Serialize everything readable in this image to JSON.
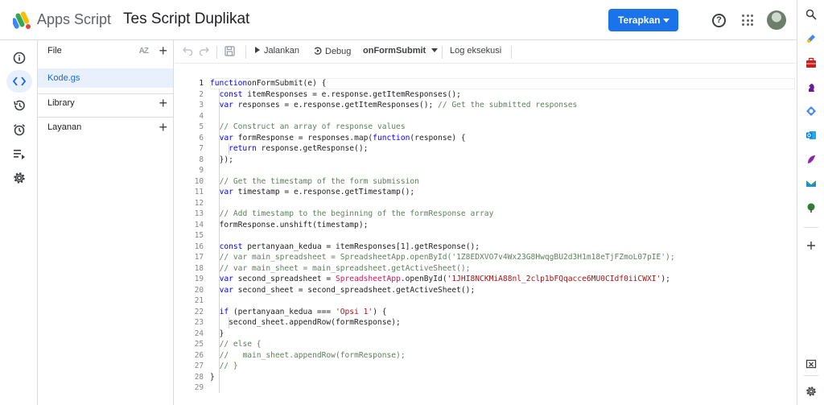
{
  "header": {
    "app_name": "Apps Script",
    "project_title": "Tes Script Duplikat",
    "deploy_label": "Terapkan",
    "icons": [
      "apps-script-logo",
      "help-icon",
      "google-apps-icon",
      "account-avatar"
    ]
  },
  "rail": {
    "items": [
      {
        "name": "overview",
        "icon": "info-icon"
      },
      {
        "name": "editor",
        "icon": "code-icon",
        "active": true
      },
      {
        "name": "project-history",
        "icon": "history-icon"
      },
      {
        "name": "triggers",
        "icon": "alarm-icon"
      },
      {
        "name": "executions",
        "icon": "executions-icon"
      },
      {
        "name": "settings",
        "icon": "gear-icon"
      }
    ]
  },
  "files": {
    "header_label": "File",
    "sort_label": "AZ",
    "file_name": "Kode.gs",
    "library_label": "Library",
    "services_label": "Layanan"
  },
  "toolbar": {
    "run_label": "Jalankan",
    "debug_label": "Debug",
    "function_label": "onFormSubmit",
    "log_label": "Log eksekusi"
  },
  "editor": {
    "line_numbers": [
      "1",
      "2",
      "3",
      "4",
      "5",
      "6",
      "7",
      "8",
      "9",
      "10",
      "11",
      "12",
      "13",
      "14",
      "15",
      "16",
      "17",
      "18",
      "19",
      "20",
      "21",
      "22",
      "23",
      "24",
      "25",
      "26",
      "27",
      "28",
      "29"
    ],
    "lines": [
      [
        [
          "kw",
          "function"
        ],
        [
          "",
          "onFormSubmit(e) {"
        ]
      ],
      [
        [
          "",
          "  "
        ],
        [
          "kw",
          "const"
        ],
        [
          "",
          " itemResponses = e.response.getItemResponses();"
        ]
      ],
      [
        [
          "",
          "  "
        ],
        [
          "kw",
          "var"
        ],
        [
          "",
          " responses = e.response.getItemResponses(); "
        ],
        [
          "cm",
          "// Get the submitted responses"
        ]
      ],
      [
        [
          "",
          ""
        ]
      ],
      [
        [
          "",
          "  "
        ],
        [
          "cm",
          "// Construct an array of response values"
        ]
      ],
      [
        [
          "",
          "  "
        ],
        [
          "kw",
          "var"
        ],
        [
          "",
          " formResponse = responses.map("
        ],
        [
          "kw",
          "function"
        ],
        [
          "",
          "(response) {"
        ]
      ],
      [
        [
          "",
          "    "
        ],
        [
          "kw",
          "return"
        ],
        [
          "",
          " response.getResponse();"
        ]
      ],
      [
        [
          "",
          "  });"
        ]
      ],
      [
        [
          "",
          ""
        ]
      ],
      [
        [
          "",
          "  "
        ],
        [
          "cm",
          "// Get the timestamp of the form submission"
        ]
      ],
      [
        [
          "",
          "  "
        ],
        [
          "kw",
          "var"
        ],
        [
          "",
          " timestamp = e.response.getTimestamp();"
        ]
      ],
      [
        [
          "",
          ""
        ]
      ],
      [
        [
          "",
          "  "
        ],
        [
          "cm",
          "// Add timestamp to the beginning of the formResponse array"
        ]
      ],
      [
        [
          "",
          "  formResponse.unshift(timestamp);"
        ]
      ],
      [
        [
          "",
          ""
        ]
      ],
      [
        [
          "",
          "  "
        ],
        [
          "kw",
          "const"
        ],
        [
          "",
          " pertanyaan_kedua = itemResponses[1].getResponse();"
        ]
      ],
      [
        [
          "",
          "  "
        ],
        [
          "cm",
          "// var main_spreadsheet = SpreadsheetApp.openById('1Z8EDXVO7v4Wx23G8HwqgBU2d3H1m18eTjFZmoL07pIE');"
        ]
      ],
      [
        [
          "",
          "  "
        ],
        [
          "cm",
          "// var main_sheet = main_spreadsheet.getActiveSheet();"
        ]
      ],
      [
        [
          "",
          "  "
        ],
        [
          "kw",
          "var"
        ],
        [
          "",
          " second_spreadsheet = "
        ],
        [
          "cls",
          "SpreadsheetApp"
        ],
        [
          "",
          ".openById("
        ],
        [
          "st",
          "'1JHI8NCKMiA88nl_2clp1bFQqacce6MU0CIdf0iiCWXI'"
        ],
        [
          "",
          ");"
        ]
      ],
      [
        [
          "",
          "  "
        ],
        [
          "kw",
          "var"
        ],
        [
          "",
          " second_sheet = second_spreadsheet.getActiveSheet();"
        ]
      ],
      [
        [
          "",
          ""
        ]
      ],
      [
        [
          "",
          "  "
        ],
        [
          "kw",
          "if"
        ],
        [
          "",
          " (pertanyaan_kedua === "
        ],
        [
          "st",
          "'Opsi 1'"
        ],
        [
          "",
          ") {"
        ]
      ],
      [
        [
          "",
          "    second_sheet.appendRow(formResponse);"
        ]
      ],
      [
        [
          "",
          "  }"
        ]
      ],
      [
        [
          "",
          "  "
        ],
        [
          "cm",
          "// else {"
        ]
      ],
      [
        [
          "",
          "  "
        ],
        [
          "cm",
          "//   main_sheet.appendRow(formResponse);"
        ]
      ],
      [
        [
          "",
          "  "
        ],
        [
          "cm",
          "// }"
        ]
      ],
      [
        [
          "",
          "}"
        ]
      ],
      [
        [
          "",
          ""
        ]
      ]
    ]
  },
  "side_panel": {
    "icons": [
      "search-icon",
      "keep-icon",
      "toolbox-icon",
      "chess-icon",
      "sync-icon",
      "outlook-icon",
      "sketch-icon",
      "mail-icon",
      "tree-icon",
      "add-icon",
      "screenshot-icon",
      "settings-icon"
    ]
  },
  "colors": {
    "accent": "#1a73e8",
    "keyword": "#0000ff",
    "comment": "#5f7f5f",
    "string": "#a31515",
    "selected_file_bg": "#e8f0fe"
  }
}
